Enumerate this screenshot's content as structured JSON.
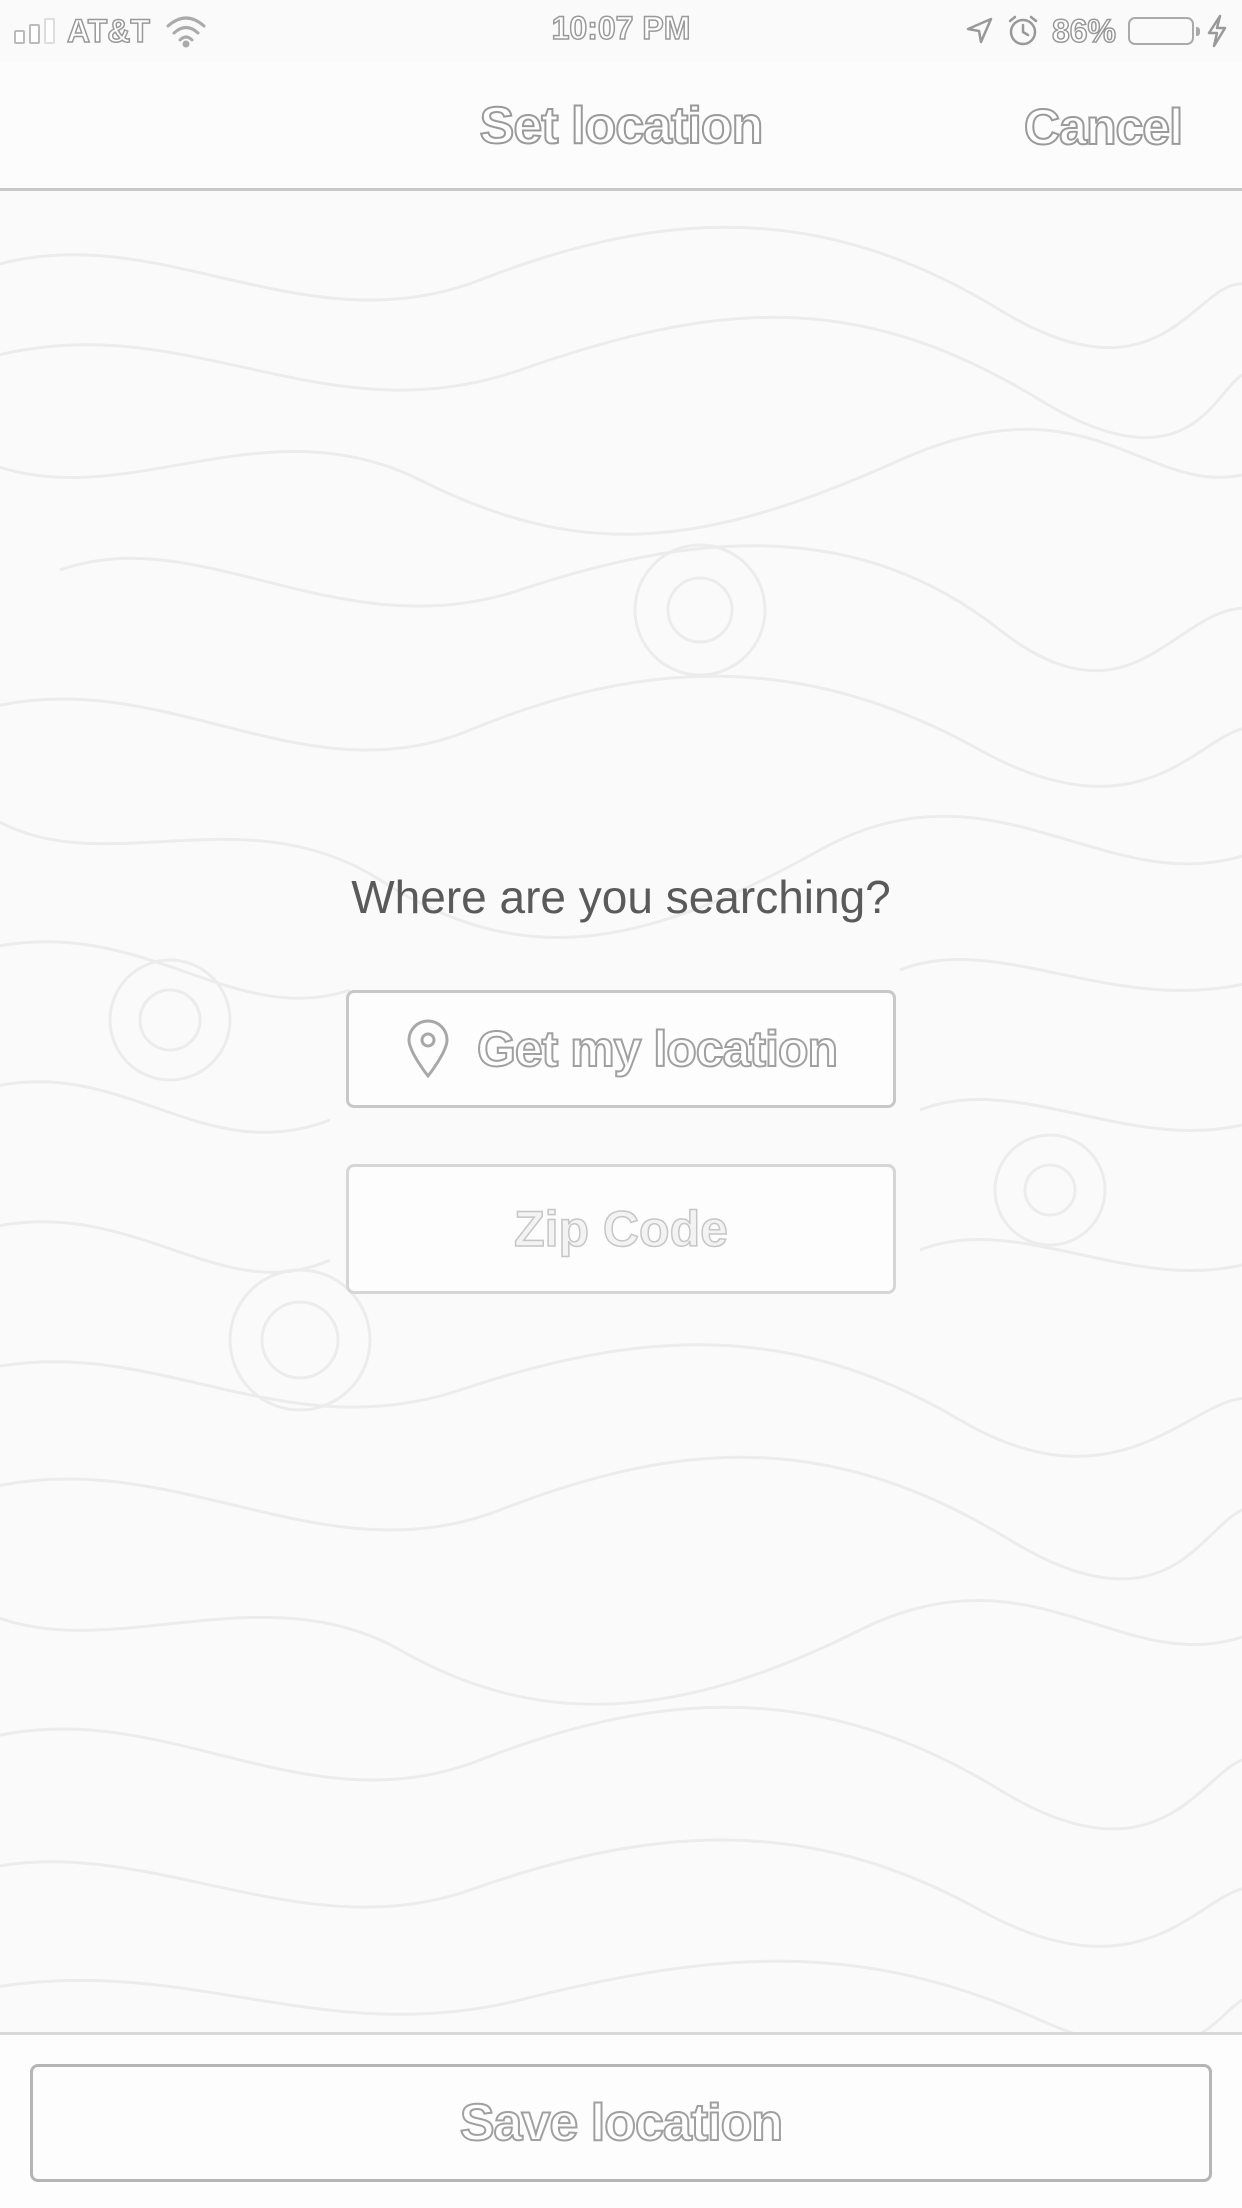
{
  "status_bar": {
    "carrier": "AT&T",
    "time": "10:07 PM",
    "battery_percent": "86%",
    "icons": [
      "signal-icon",
      "wifi-icon",
      "location-arrow-icon",
      "alarm-icon",
      "battery-icon",
      "charging-icon"
    ]
  },
  "nav": {
    "title": "Set location",
    "cancel_label": "Cancel"
  },
  "main": {
    "prompt": "Where are you searching?",
    "location_button_label": "Get my location",
    "location_button_icon": "map-pin-icon",
    "zip_placeholder": "Zip Code",
    "zip_value": ""
  },
  "footer": {
    "save_label": "Save location"
  }
}
